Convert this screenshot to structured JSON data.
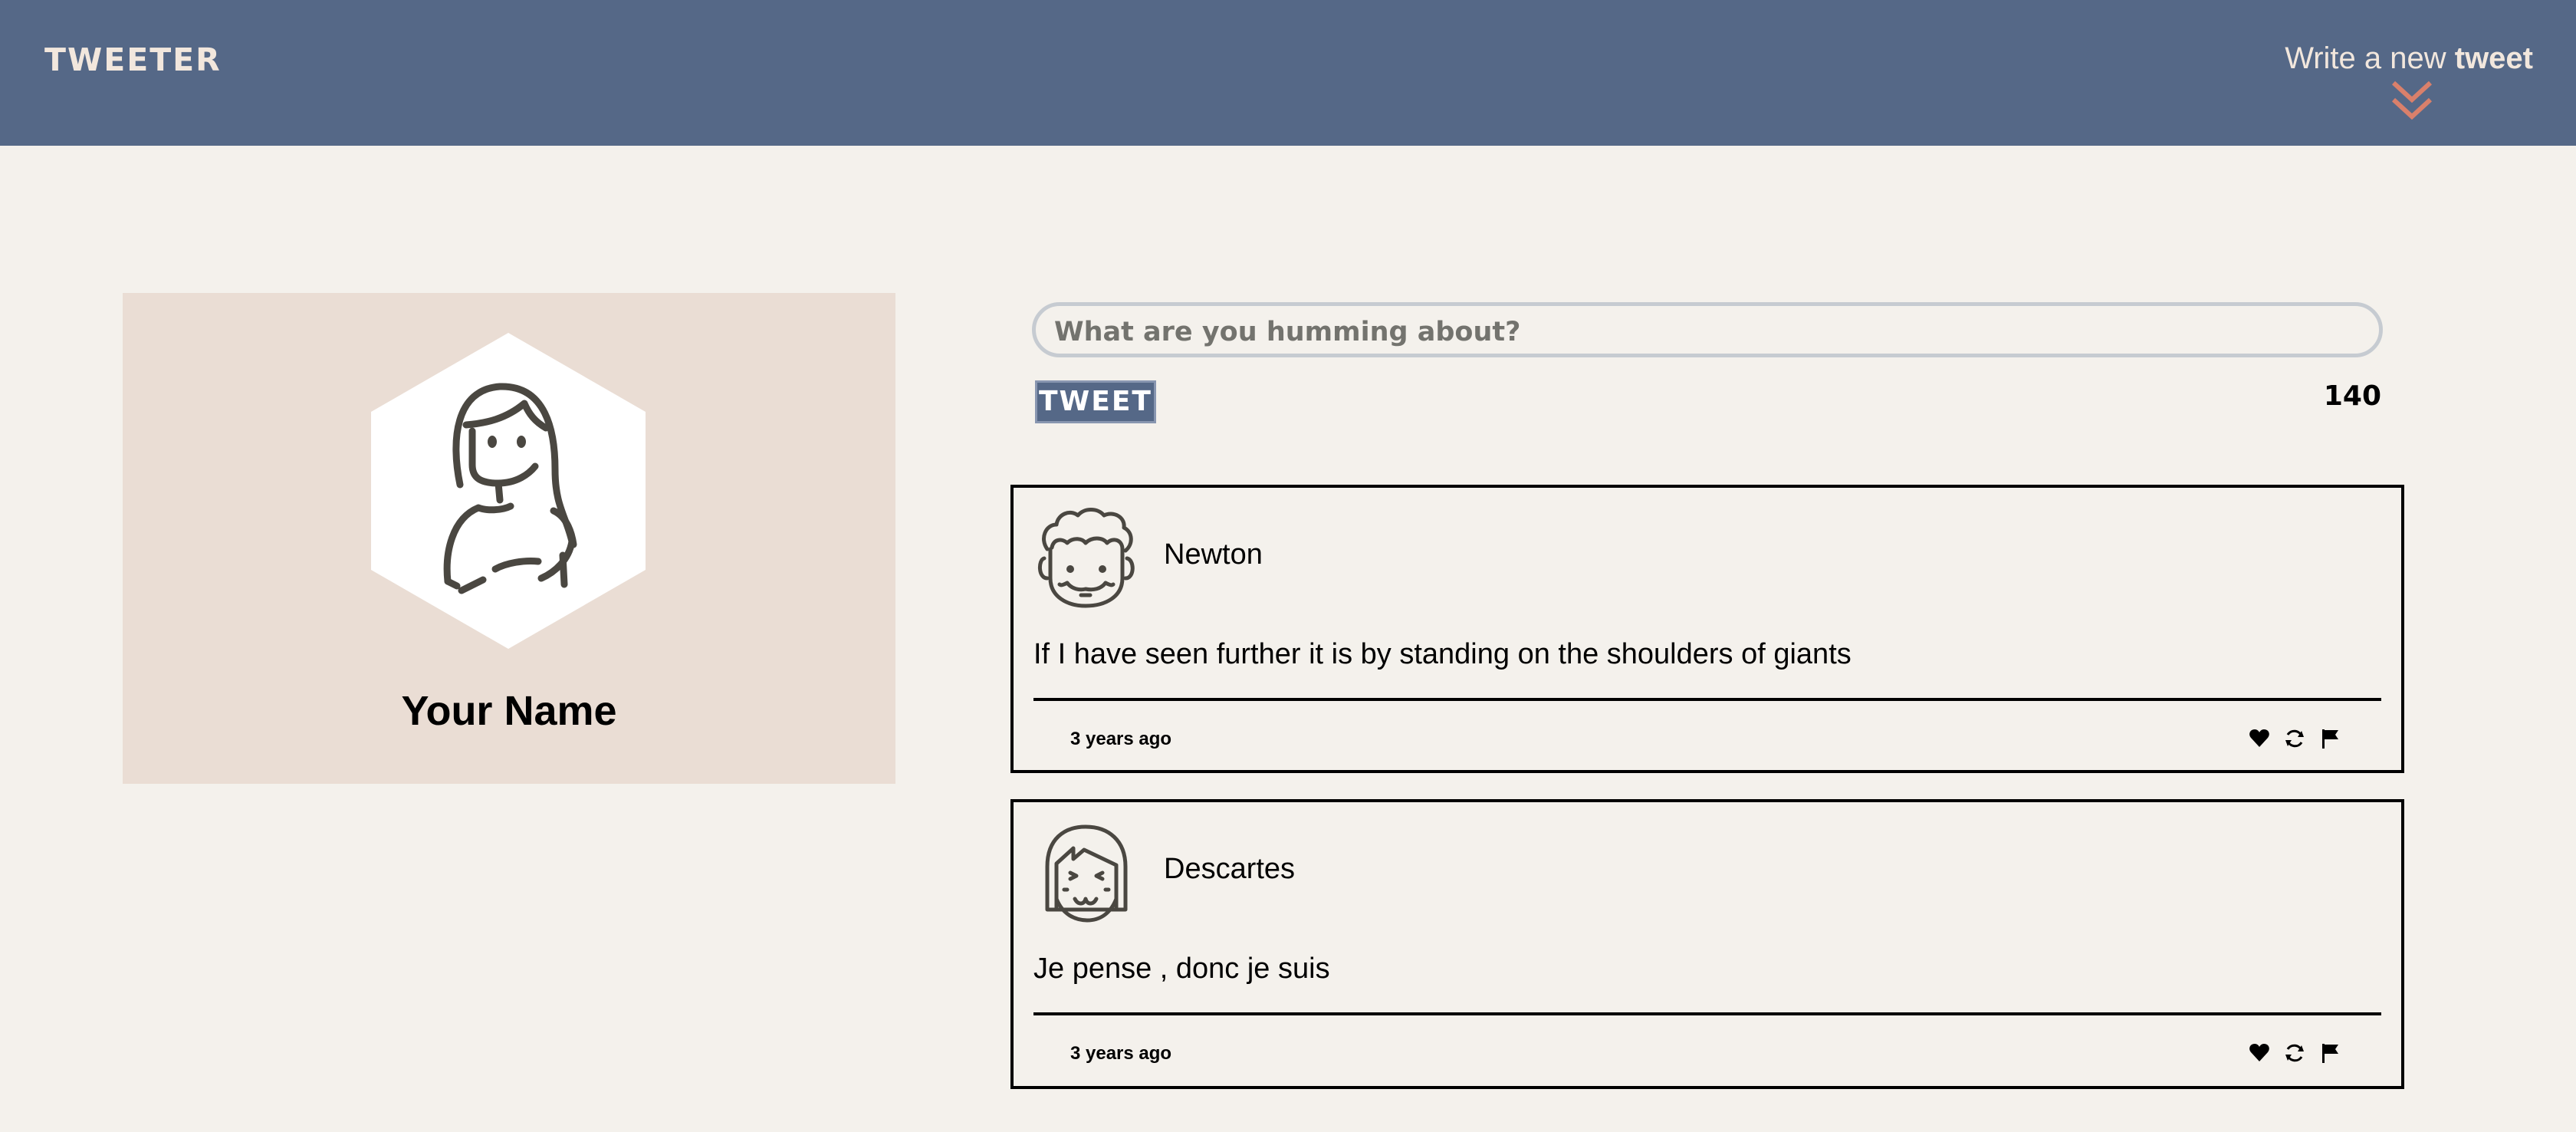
{
  "nav": {
    "brand": "TWEETER",
    "compose_prefix": "Write a new ",
    "compose_bold": "tweet",
    "chevron_icon": "double-chevron-down-icon",
    "chevron_color": "#d9806b"
  },
  "profile": {
    "name": "Your Name",
    "avatar_icon": "woman-avatar-icon"
  },
  "compose": {
    "placeholder": "What are you humming about?",
    "button_label": "TWEET",
    "counter": "140"
  },
  "tweets": [
    {
      "author": "Newton",
      "avatar_icon": "curly-hair-man-avatar-icon",
      "content": "If I have seen further it is by standing on the shoulders of giants",
      "time": "3 years ago",
      "actions": [
        "heart-icon",
        "retweet-icon",
        "flag-icon"
      ]
    },
    {
      "author": "Descartes",
      "avatar_icon": "bob-hair-avatar-icon",
      "content": "Je pense , donc je suis",
      "time": "3 years ago",
      "actions": [
        "heart-icon",
        "retweet-icon",
        "flag-icon"
      ]
    }
  ],
  "colors": {
    "nav_bg": "#556887",
    "page_bg": "#f4f1ec",
    "profile_bg": "#eaddd4",
    "accent": "#d9806b"
  }
}
